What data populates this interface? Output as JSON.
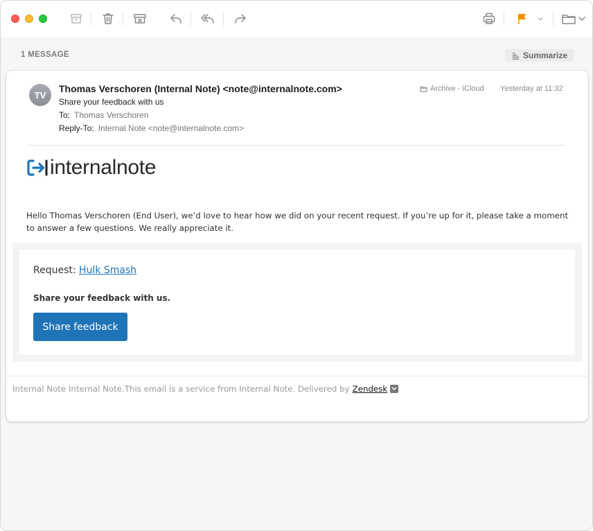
{
  "toolbar": {
    "icons": [
      "archive-icon",
      "trash-icon",
      "junk-icon",
      "reply-icon",
      "reply-all-icon",
      "forward-icon",
      "print-icon",
      "flag-icon",
      "chevron-down-icon",
      "move-to-folder-icon"
    ],
    "flag_color": "#f39200"
  },
  "thread": {
    "count_label": "1 MESSAGE",
    "summarize_label": "Summarize"
  },
  "message": {
    "avatar_initials": "TV",
    "sender": "Thomas Verschoren (Internal Note) <note@internalnote.com>",
    "subject": "Share your feedback with us",
    "to_label": "To:",
    "to_value": "Thomas Verschoren",
    "reply_to_label": "Reply-To:",
    "reply_to_value": "Internal Note <note@internalnote.com>",
    "mailbox": "Archive - iCloud",
    "date": "Yesterday at 11:32"
  },
  "body": {
    "logo_text": "internalnote",
    "intro": "Hello Thomas Verschoren (End User), we’d love to hear how we did on your recent request. If you’re up for it, please take a moment to answer a few questions. We really appreciate it.",
    "request_label": "Request:",
    "request_link": "Hulk Smash",
    "share_text": "Share your feedback with us.",
    "share_button": "Share feedback",
    "footer_text": "Internal Note Internal Note.This email is a service from Internal Note. Delivered by",
    "footer_link": "Zendesk",
    "accent_color": "#1f73b7"
  }
}
